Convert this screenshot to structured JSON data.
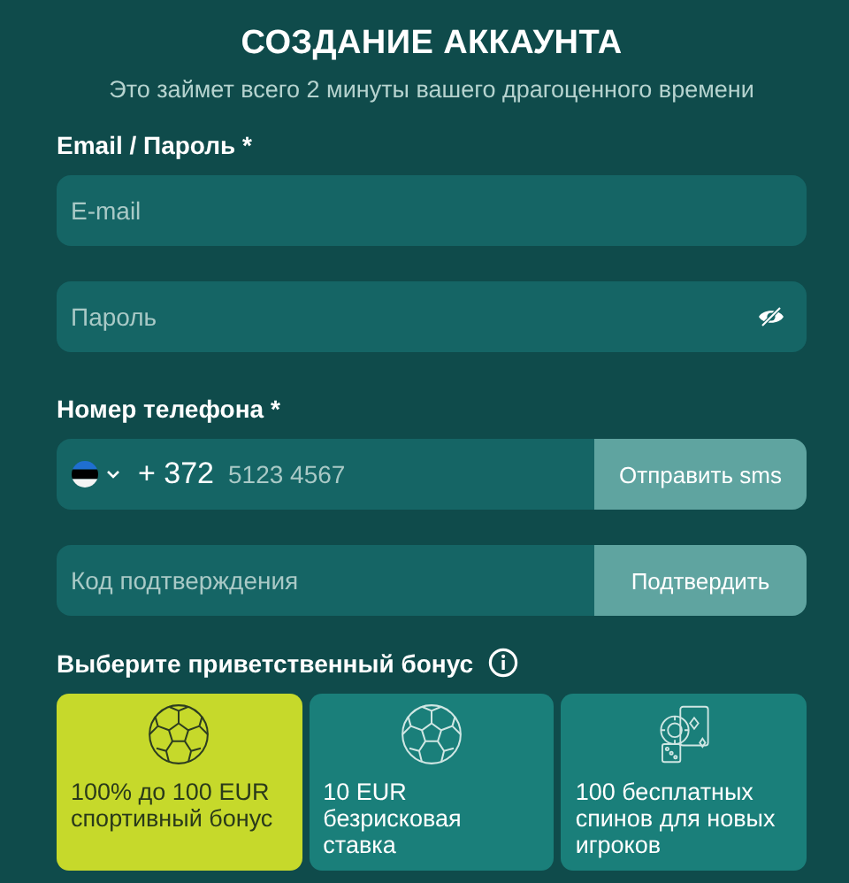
{
  "header": {
    "title": "СОЗДАНИЕ АККАУНТА",
    "subtitle": "Это займет всего 2 минуты вашего драгоценного времени"
  },
  "credentials": {
    "label": "Email / Пароль *",
    "email": {
      "placeholder": "E-mail"
    },
    "password": {
      "placeholder": "Пароль"
    }
  },
  "phone": {
    "label": "Номер телефона *",
    "country_code": "+ 372",
    "number": {
      "placeholder": "5123 4567"
    },
    "send_button": "Отправить sms"
  },
  "confirmation": {
    "code": {
      "placeholder": "Код подтверждения"
    },
    "confirm_button": "Подтвердить"
  },
  "bonus": {
    "label": "Выберите приветственный бонус",
    "options": [
      {
        "kind": "sports",
        "text": "100% до 100 EUR спортивный бонус",
        "selected": true
      },
      {
        "kind": "sports",
        "text": "10 EUR безрисковая ставка",
        "selected": false
      },
      {
        "kind": "casino",
        "text": "100 бесплатных спинов для новых игроков",
        "selected": false
      }
    ]
  }
}
